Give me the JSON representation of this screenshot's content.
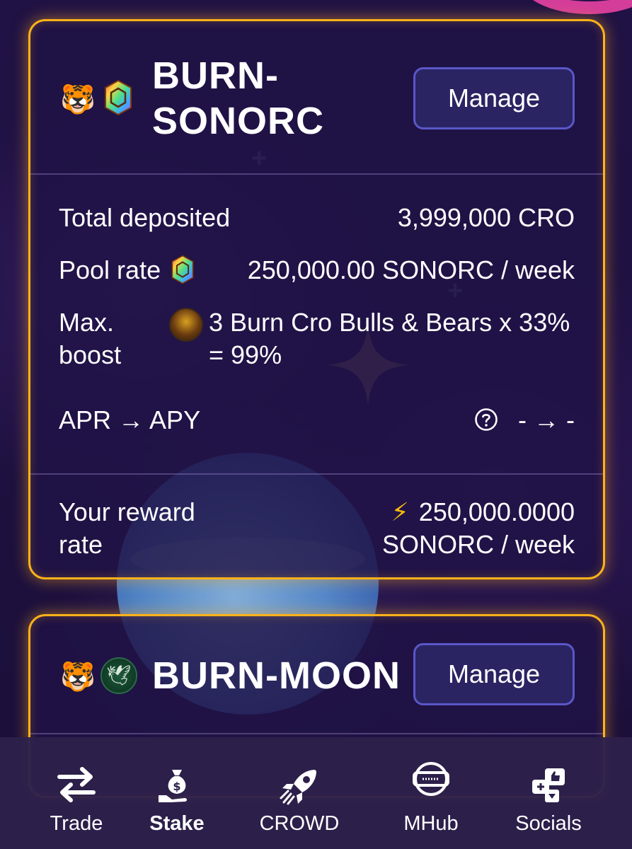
{
  "pools": [
    {
      "title": "BURN-SONORC",
      "manage_label": "Manage",
      "tokens": [
        "tiger-token-icon",
        "sonorc-token-icon"
      ],
      "total_deposited_label": "Total deposited",
      "total_deposited_value": "3,999,000 CRO",
      "pool_rate_label": "Pool rate",
      "pool_rate_value": "250,000.00 SONORC / week",
      "max_boost_label": "Max. boost",
      "max_boost_value": "3 Burn Cro Bulls & Bears x 33% = 99%",
      "apr_label": "APR → APY",
      "apr_value": "- → -",
      "reward_label": "Your reward rate",
      "reward_value_line1": "250,000.0000",
      "reward_value_line2": "SONORC / week"
    },
    {
      "title": "BURN-MOON",
      "manage_label": "Manage",
      "tokens": [
        "tiger-token-icon",
        "moon-token-icon"
      ]
    }
  ],
  "nav": {
    "items": [
      {
        "label": "Trade",
        "icon": "swap-arrows-icon",
        "active": false
      },
      {
        "label": "Stake",
        "icon": "money-bag-hand-icon",
        "active": true
      },
      {
        "label": "CROWD",
        "icon": "rocket-icon",
        "active": false
      },
      {
        "label": "MHub",
        "icon": "vr-headset-icon",
        "active": false
      },
      {
        "label": "Socials",
        "icon": "social-bubbles-icon",
        "active": false
      }
    ]
  },
  "colors": {
    "card_border": "#ffb21a",
    "button_bg": "#2a2463",
    "button_border": "#5a57c8",
    "background": "#1c0f3a",
    "bolt": "#f5b80e"
  }
}
